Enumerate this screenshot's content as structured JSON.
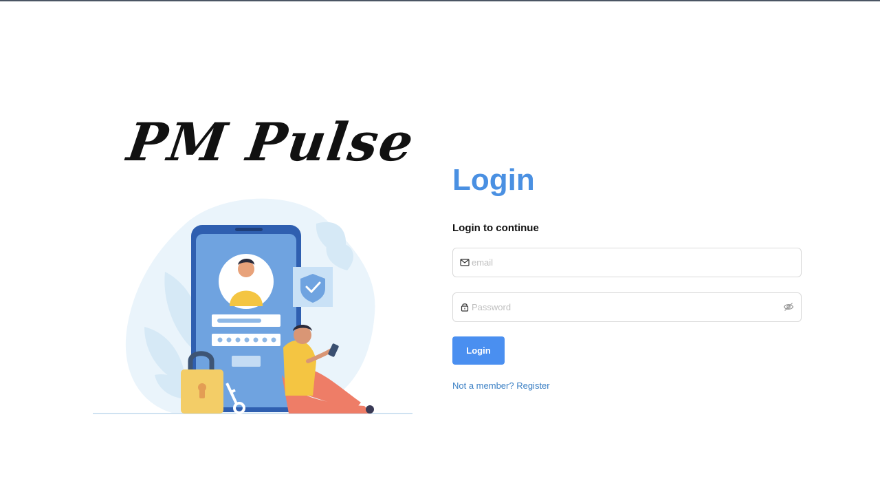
{
  "brand": {
    "logo_text": "PM Pulse"
  },
  "login": {
    "title": "Login",
    "subtitle": "Login to continue",
    "email_placeholder": "email",
    "email_value": "",
    "password_placeholder": "Password",
    "password_value": "",
    "button_label": "Login",
    "register_link": "Not a member? Register"
  },
  "icons": {
    "email": "mail-icon",
    "password": "lock-icon",
    "toggle": "eye-slash-icon"
  },
  "colors": {
    "title": "#4a90e2",
    "button": "#4a8ff0",
    "link": "#3a7fc4"
  }
}
